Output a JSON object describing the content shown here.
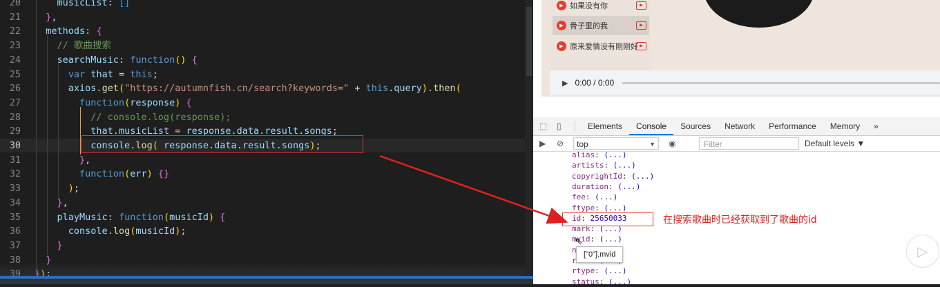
{
  "editor": {
    "lines": [
      {
        "n": "20",
        "text": "    musicList: []"
      },
      {
        "n": "21",
        "text": "  },"
      },
      {
        "n": "22",
        "text": "  methods: {"
      },
      {
        "n": "23",
        "text": "    // 歌曲搜索"
      },
      {
        "n": "24",
        "text": "    searchMusic: function() {"
      },
      {
        "n": "25",
        "text": "      var that = this;"
      },
      {
        "n": "26",
        "text": "      axios.get(\"https://autumnfish.cn/search?keywords=\" + this.query).then("
      },
      {
        "n": "27",
        "text": "        function(response) {"
      },
      {
        "n": "28",
        "text": "          // console.log(response);"
      },
      {
        "n": "29",
        "text": "          that.musicList = response.data.result.songs;"
      },
      {
        "n": "30",
        "text": "          console.log( response.data.result.songs);"
      },
      {
        "n": "31",
        "text": "        },"
      },
      {
        "n": "32",
        "text": "        function(err) {}"
      },
      {
        "n": "33",
        "text": "      );"
      },
      {
        "n": "34",
        "text": "    },"
      },
      {
        "n": "35",
        "text": "    playMusic: function(musicId) {"
      },
      {
        "n": "36",
        "text": "      console.log(musicId);"
      },
      {
        "n": "37",
        "text": "    }"
      },
      {
        "n": "38",
        "text": "  }"
      },
      {
        "n": "39",
        "text": "});"
      }
    ],
    "active_line": "30"
  },
  "player": {
    "songs": [
      "如果没有你",
      "骨子里的我",
      "原来爱情没有刚刚好"
    ],
    "selected_song": "骨子里的我",
    "time": "0:00 / 0:00"
  },
  "devtools": {
    "tabs": [
      "Elements",
      "Console",
      "Sources",
      "Network",
      "Performance",
      "Memory"
    ],
    "active_tab": "Console",
    "more": "»",
    "context": "top",
    "filter_placeholder": "Filter",
    "levels": "Default levels ▼",
    "properties": [
      {
        "k": "alias",
        "v": "(...)"
      },
      {
        "k": "artists",
        "v": "(...)"
      },
      {
        "k": "copyrightId",
        "v": "(...)"
      },
      {
        "k": "duration",
        "v": "(...)"
      },
      {
        "k": "fee",
        "v": "(...)"
      },
      {
        "k": "ftype",
        "v": "(...)"
      },
      {
        "k": "id",
        "v": "25650033"
      },
      {
        "k": "mark",
        "v": "(...)"
      },
      {
        "k": "mvid",
        "v": "(...)"
      },
      {
        "k": "name",
        "v": "(...)"
      },
      {
        "k": "rUrl",
        "v": "(...)"
      },
      {
        "k": "rtype",
        "v": "(...)"
      },
      {
        "k": "status",
        "v": "(...)"
      }
    ],
    "tooltip": "[\"0\"].mvid"
  },
  "annotation": {
    "note": "在搜索歌曲时已经获取到了歌曲的id",
    "color": "#e02020"
  }
}
